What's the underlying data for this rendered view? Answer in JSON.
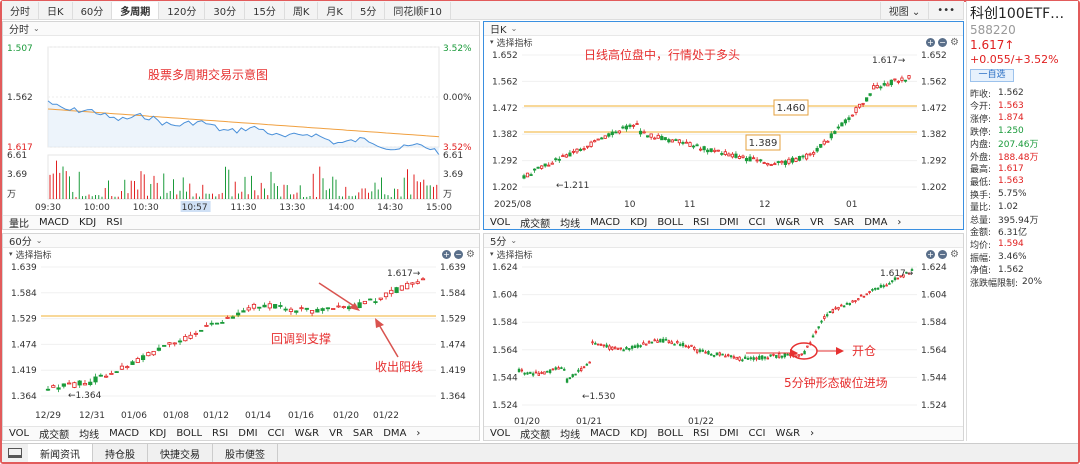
{
  "period_tabs": [
    "分时",
    "日K",
    "60分",
    "多周期",
    "120分",
    "30分",
    "15分",
    "周K",
    "月K",
    "5分",
    "同花顺F10"
  ],
  "active_period": "多周期",
  "view_label": "视图",
  "stock": {
    "name": "科创100ETF…",
    "code": "588220",
    "price": "1.617↑",
    "change": "+0.055/+3.52%",
    "watch_button": "一自选"
  },
  "quote": [
    {
      "k": "昨收:",
      "v": "1.562",
      "c": "#333"
    },
    {
      "k": "今开:",
      "v": "1.563",
      "c": "#e02020"
    },
    {
      "k": "涨停:",
      "v": "1.874",
      "c": "#e02020"
    },
    {
      "k": "跌停:",
      "v": "1.250",
      "c": "#1a9a3a"
    },
    {
      "k": "内盘:",
      "v": "207.46万",
      "c": "#1a9a3a"
    },
    {
      "k": "外盘:",
      "v": "188.48万",
      "c": "#e02020"
    },
    {
      "k": "最高:",
      "v": "1.617",
      "c": "#e02020"
    },
    {
      "k": "最低:",
      "v": "1.563",
      "c": "#e02020"
    },
    {
      "k": "换手:",
      "v": "5.75%",
      "c": "#333"
    },
    {
      "k": "量比:",
      "v": "1.02",
      "c": "#333"
    },
    {
      "k": "总量:",
      "v": "395.94万",
      "c": "#333"
    },
    {
      "k": "金额:",
      "v": "6.31亿",
      "c": "#333"
    },
    {
      "k": "均价:",
      "v": "1.594",
      "c": "#e02020"
    },
    {
      "k": "振幅:",
      "v": "3.46%",
      "c": "#333"
    },
    {
      "k": "净值:",
      "v": "1.562",
      "c": "#333"
    },
    {
      "k": "涨跌幅限制:",
      "v": "20%",
      "c": "#333"
    }
  ],
  "colors": {
    "up": "#e02020",
    "down": "#1a9a3a",
    "price_line": "#4a90d9",
    "avg_line": "#f0a040",
    "support_line": "#f0b030",
    "annotation": "#e63030"
  },
  "panels": {
    "minute": {
      "title": "分时",
      "annotation": "股票多周期交易示意图",
      "price_ticks": [
        "1.507",
        "1.562",
        "1.617"
      ],
      "pct_ticks": [
        "3.52%",
        "0.00%",
        "3.52%"
      ],
      "vol_ticks": [
        "6.61",
        "3.69",
        "万"
      ],
      "time_ticks": [
        "09:30",
        "10:00",
        "10:30",
        "10:57",
        "11:30",
        "13:30",
        "14:00",
        "14:30",
        "15:00"
      ],
      "indicators": [
        "量比",
        "MACD",
        "KDJ",
        "RSI"
      ]
    },
    "daily": {
      "title": "日K",
      "selector": "选择指标",
      "annotation": "日线高位盘中，行情处于多头",
      "y_ticks": [
        "1.652",
        "1.562",
        "1.472",
        "1.382",
        "1.292",
        "1.202"
      ],
      "x_ticks": [
        "2025/08",
        "10",
        "11",
        "12",
        "01"
      ],
      "low_label": "←1.211",
      "high_label": "1.617→",
      "box1": "1.460",
      "box2": "1.389",
      "indicators": [
        "VOL",
        "成交额",
        "均线",
        "MACD",
        "KDJ",
        "BOLL",
        "RSI",
        "DMI",
        "CCI",
        "W&R",
        "VR",
        "SAR",
        "DMA",
        "›"
      ]
    },
    "m60": {
      "title": "60分",
      "selector": "选择指标",
      "y_ticks": [
        "1.639",
        "1.584",
        "1.529",
        "1.474",
        "1.419",
        "1.364"
      ],
      "x_ticks": [
        "12/29",
        "12/31",
        "01/06",
        "01/08",
        "01/12",
        "01/14",
        "01/16",
        "01/20",
        "01/22"
      ],
      "low_label": "←1.364",
      "high_label": "1.617→",
      "ann1": "回调到支撑",
      "ann2": "收出阳线",
      "indicators": [
        "VOL",
        "成交额",
        "均线",
        "MACD",
        "KDJ",
        "BOLL",
        "RSI",
        "DMI",
        "CCI",
        "W&R",
        "VR",
        "SAR",
        "DMA",
        "›"
      ]
    },
    "m5": {
      "title": "5分",
      "selector": "选择指标",
      "y_ticks": [
        "1.624",
        "1.604",
        "1.584",
        "1.564",
        "1.544",
        "1.524"
      ],
      "x_ticks": [
        "01/20",
        "01/21",
        "01/22"
      ],
      "low_label": "←1.530",
      "high_label": "1.617→",
      "ann1": "开仓",
      "ann2": "5分钟形态破位进场",
      "indicators": [
        "VOL",
        "成交额",
        "均线",
        "MACD",
        "KDJ",
        "BOLL",
        "RSI",
        "DMI",
        "CCI",
        "W&R",
        "›"
      ]
    }
  },
  "bottom_tabs": [
    "新闻资讯",
    "持仓股",
    "快捷交易",
    "股市便签"
  ]
}
